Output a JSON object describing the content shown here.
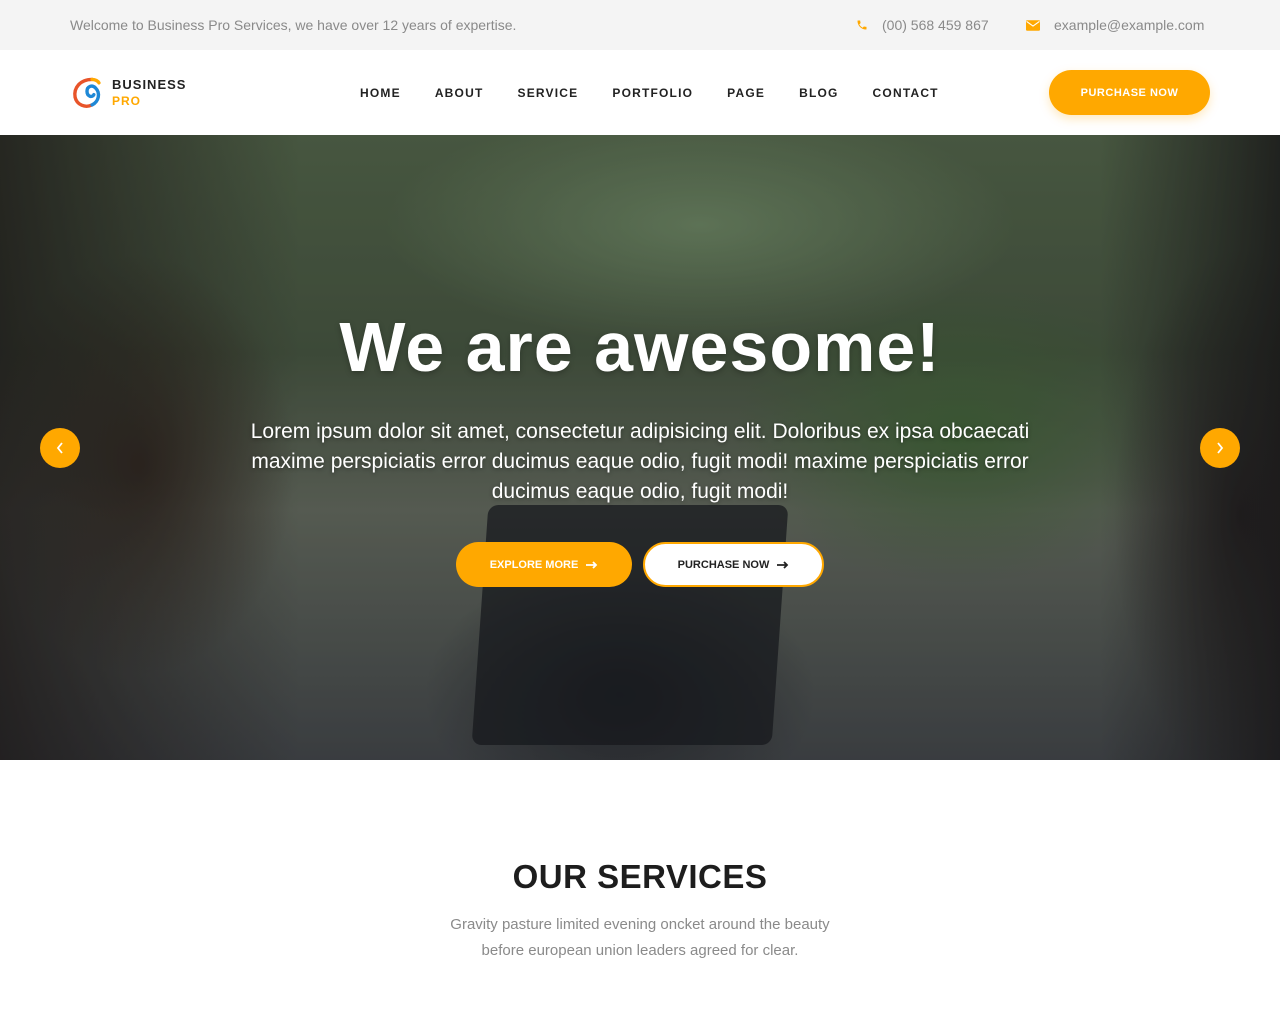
{
  "topbar": {
    "welcome": "Welcome to Business Pro Services, we have over 12 years of expertise.",
    "phone": "(00) 568 459 867",
    "email": "example@example.com",
    "phone_icon": "phone-icon",
    "email_icon": "envelope-icon"
  },
  "header": {
    "logo_line1": "BUSINESS",
    "logo_line2": "PRO",
    "nav": [
      "HOME",
      "ABOUT",
      "SERVICE",
      "PORTFOLIO",
      "PAGE",
      "BLOG",
      "CONTACT"
    ],
    "cta": "PURCHASE NOW"
  },
  "hero": {
    "title": "We are awesome!",
    "text": "Lorem ipsum dolor sit amet, consectetur adipisicing elit. Doloribus ex ipsa obcaecati maxime perspiciatis error ducimus eaque odio, fugit modi! maxime perspiciatis error ducimus eaque odio, fugit modi!",
    "explore_label": "EXPLORE MORE",
    "purchase_label": "PURCHASE NOW"
  },
  "services": {
    "title": "OUR SERVICES",
    "subtitle_line1": "Gravity pasture limited evening oncket around the beauty",
    "subtitle_line2": "before european union leaders agreed for clear."
  },
  "colors": {
    "accent": "#ffa800",
    "topbar_bg": "#f4f4f4",
    "text_dark": "#222222",
    "text_muted": "#8a8a8a"
  }
}
